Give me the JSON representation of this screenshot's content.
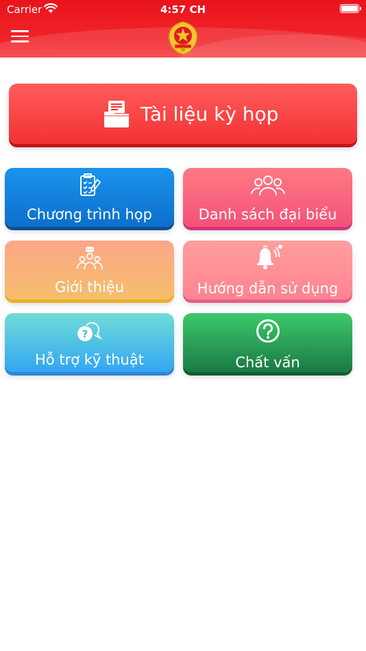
{
  "status_bar": {
    "carrier": "Carrier",
    "time": "4:57 CH"
  },
  "header": {
    "menu_icon": "hamburger-menu-icon",
    "emblem_icon": "national-emblem-icon",
    "background_color": "#e8141b"
  },
  "main_button": {
    "label": "Tài liệu kỳ họp",
    "icon": "document-folder-icon",
    "color": "#f23232"
  },
  "tiles": [
    {
      "label": "Chương trình họp",
      "icon": "clipboard-checklist-icon",
      "color": "#0d6fca"
    },
    {
      "label": "Danh sách đại biểu",
      "icon": "people-group-icon",
      "color": "#f4517a"
    },
    {
      "label": "Giới thiệu",
      "icon": "people-speech-icon",
      "color": "#f5be6b"
    },
    {
      "label": "Hướng dẫn sử dụng",
      "icon": "notification-bell-icon",
      "color": "#ff8392"
    },
    {
      "label": "Hỗ trợ kỹ thuật",
      "icon": "help-chat-icon",
      "color": "#32a6f2"
    },
    {
      "label": "Chất vấn",
      "icon": "question-circle-icon",
      "color": "#1a7a45"
    }
  ]
}
